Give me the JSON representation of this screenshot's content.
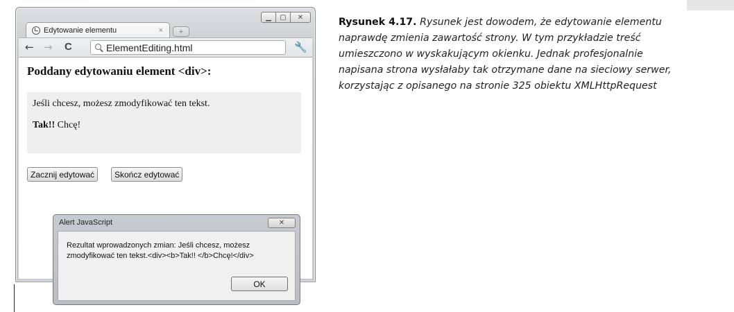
{
  "browser": {
    "tab_title": "Edytowanie elementu",
    "tab_close": "×",
    "new_tab": "+",
    "window_controls": {
      "minimize": "▁",
      "maximize": "▢",
      "close": "✕"
    },
    "nav": {
      "back": "←",
      "forward": "→",
      "reload": "C",
      "menu": "🔧"
    },
    "address": "ElementEditing.html"
  },
  "page": {
    "heading": "Poddany edytowaniu element <div>:",
    "editable_text": "Jeśli chcesz, możesz zmodyfikować ten tekst.",
    "editable_bold": "Tak!!",
    "editable_rest": " Chcę!",
    "start_button": "Zacznij edytować",
    "stop_button": "Skończ edytować"
  },
  "alert": {
    "title": "Alert JavaScript",
    "close": "✕",
    "message": "Rezultat wprowadzonych zmian: Jeśli chcesz, możesz zmodyfikować ten tekst.<div><b>Tak!! </b>Chcę!</div>",
    "ok": "OK"
  },
  "caption": {
    "label": "Rysunek 4.17.",
    "text": " Rysunek jest dowodem, że edytowanie elementu naprawdę zmienia zawartość strony. W tym przykładzie treść umieszczono w wyskakującym okienku. Jednak profesjonalnie napisana strona wysłałaby tak otrzymane dane na sieciowy serwer, korzystając z opisanego na stronie 325 obiektu XMLHttpRequest"
  }
}
